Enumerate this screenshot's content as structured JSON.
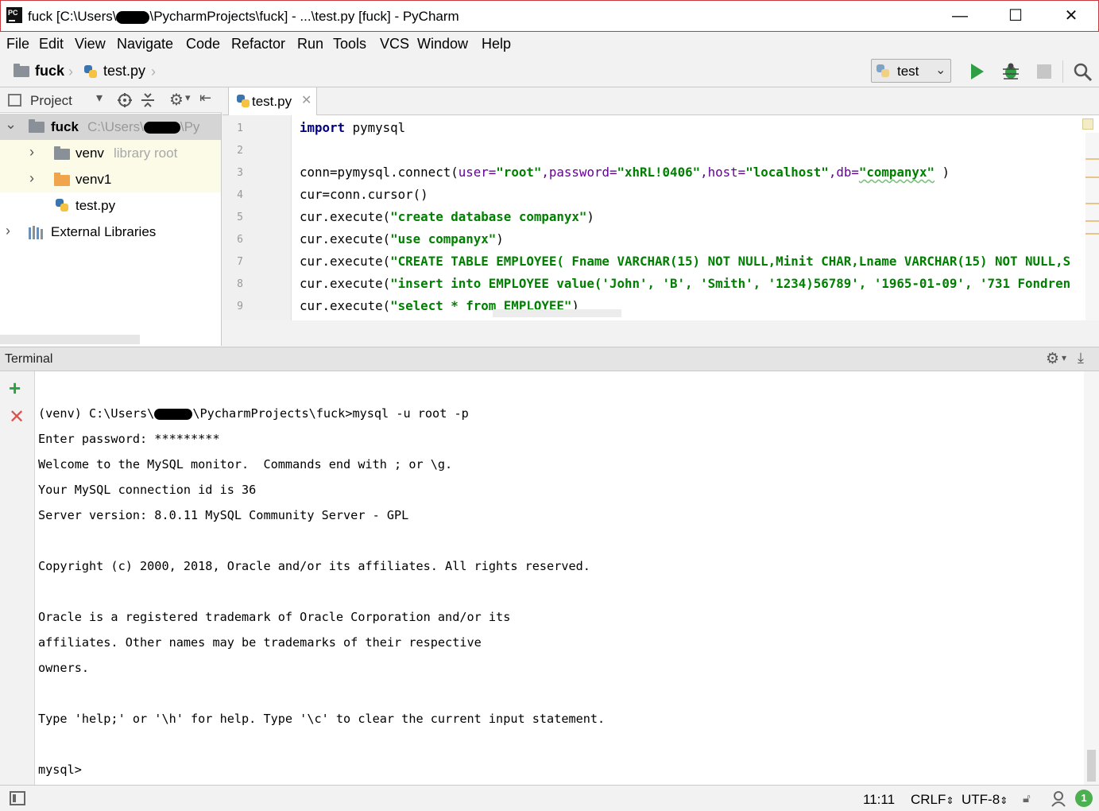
{
  "window": {
    "title_prefix": "fuck [C:\\Users\\",
    "title_suffix": "\\PycharmProjects\\fuck] - ...\\test.py [fuck] - PyCharm",
    "minimize": "—",
    "maximize": "☐",
    "close": "✕"
  },
  "menu": [
    "File",
    "Edit",
    "View",
    "Navigate",
    "Code",
    "Refactor",
    "Run",
    "Tools",
    "VCS",
    "Window",
    "Help"
  ],
  "breadcrumb": {
    "project": "fuck",
    "file": "test.py"
  },
  "run_config": {
    "selected": "test"
  },
  "project_panel": {
    "title": "Project",
    "root": {
      "name": "fuck",
      "path_prefix": "C:\\Users\\",
      "path_suffix": "\\Py"
    },
    "items": [
      {
        "name": "venv",
        "note": "library root"
      },
      {
        "name": "venv1",
        "note": ""
      },
      {
        "name": "test.py",
        "note": ""
      },
      {
        "name": "External Libraries",
        "note": ""
      }
    ]
  },
  "editor": {
    "tab": "test.py",
    "line_numbers": [
      "1",
      "2",
      "3",
      "4",
      "5",
      "6",
      "7",
      "8",
      "9"
    ],
    "code": {
      "l1_kw": "import",
      "l1_rest": " pymysql",
      "l3_a": "conn=pymysql.connect(",
      "l3_p1": "user=",
      "l3_s1": "\"root\"",
      "l3_p2": ",password=",
      "l3_s2": "\"xhRL!0406\"",
      "l3_p3": ",host=",
      "l3_s3": "\"localhost\"",
      "l3_p4": ",db=",
      "l3_s4": "\"companyx\"",
      "l3_end": " )",
      "l4": "cur=conn.cursor()",
      "l5_a": "cur.execute(",
      "l5_s": "\"create database companyx\"",
      "l5_end": ")",
      "l6_a": "cur.execute(",
      "l6_s": "\"use companyx\"",
      "l6_end": ")",
      "l7_a": "cur.execute(",
      "l7_s": "\"CREATE TABLE EMPLOYEE( Fname VARCHAR(15) NOT NULL,Minit CHAR,Lname VARCHAR(15) NOT NULL,S",
      "l8_a": "cur.execute(",
      "l8_s": "\"insert into EMPLOYEE value('John', 'B', 'Smith', '1234)56789', '1965-01-09', '731 Fondren",
      "l9_a": "cur.execute(",
      "l9_s": "\"select * from EMPLOYEE\"",
      "l9_end": ")"
    }
  },
  "terminal": {
    "title": "Terminal",
    "prompt_prefix": "(venv) C:\\Users\\",
    "prompt_suffix": "\\PycharmProjects\\fuck>mysql -u root -p",
    "lines": [
      "Enter password: *********",
      "Welcome to the MySQL monitor.  Commands end with ; or \\g.",
      "Your MySQL connection id is 36",
      "Server version: 8.0.11 MySQL Community Server - GPL",
      "Copyright (c) 2000, 2018, Oracle and/or its affiliates. All rights reserved.",
      "Oracle is a registered trademark of Oracle Corporation and/or its",
      "affiliates. Other names may be trademarks of their respective",
      "owners.",
      "Type 'help;' or '\\h' for help. Type '\\c' to clear the current input statement.",
      "mysql>"
    ]
  },
  "status": {
    "position": "11:11",
    "line_sep": "CRLF",
    "encoding": "UTF-8",
    "notifications": "1"
  },
  "colors": {
    "run_green": "#2ea043",
    "string_green": "#008000",
    "keyword_navy": "#000080",
    "param_purple": "#660099",
    "delete_red": "#d9534f",
    "highlight_yellow": "#fbfbe8"
  }
}
